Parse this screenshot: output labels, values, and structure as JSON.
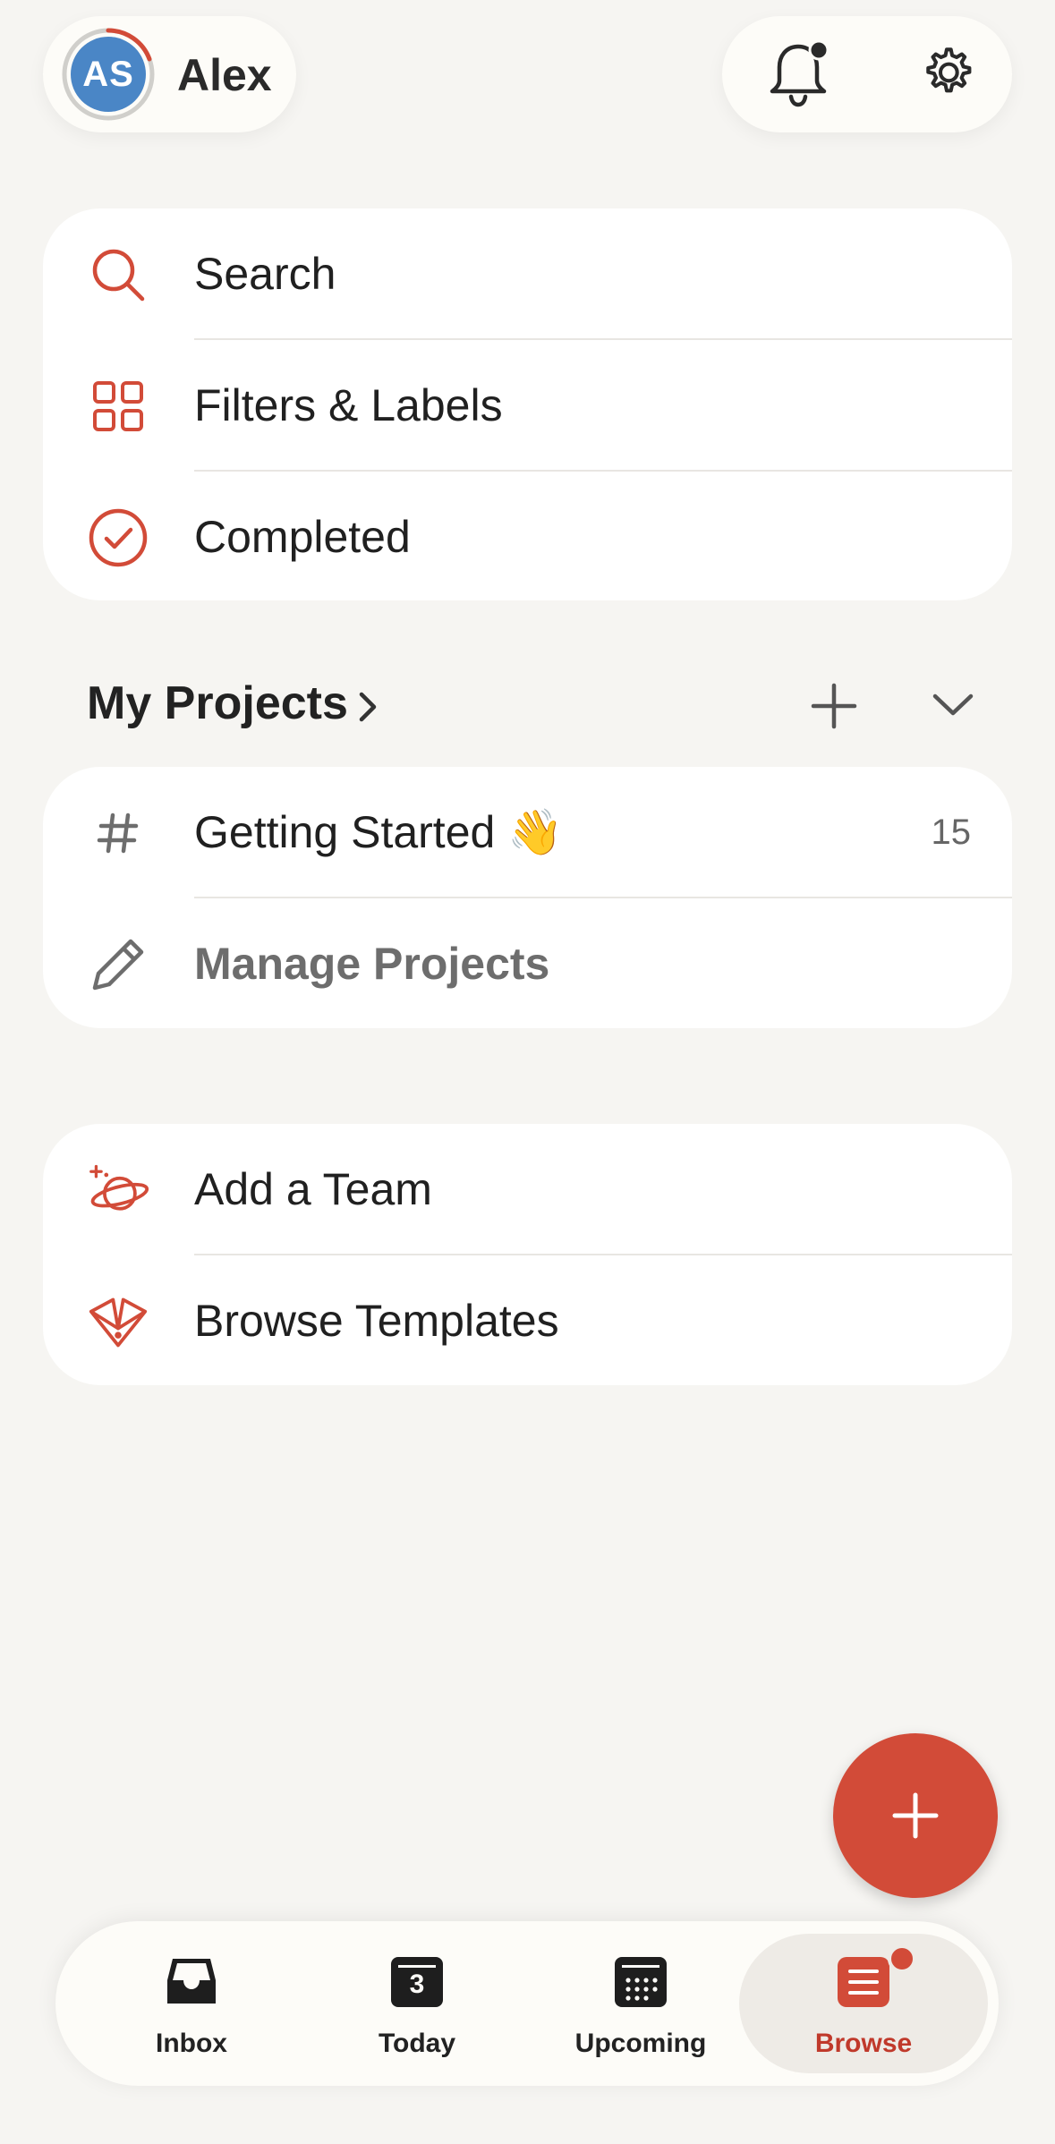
{
  "colors": {
    "accent": "#d24b38",
    "avatar": "#4a86c6",
    "background": "#f6f5f2"
  },
  "profile": {
    "initials": "AS",
    "name": "Alex"
  },
  "header_actions": {
    "notifications_icon": "bell-icon",
    "settings_icon": "gear-icon"
  },
  "quick_links": [
    {
      "label": "Search",
      "icon": "search-icon"
    },
    {
      "label": "Filters & Labels",
      "icon": "grid-icon"
    },
    {
      "label": "Completed",
      "icon": "check-circle-icon"
    }
  ],
  "projects_section": {
    "title": "My Projects"
  },
  "projects": [
    {
      "label": "Getting Started 👋",
      "count": "15",
      "icon": "hash-icon"
    },
    {
      "label": "Manage Projects",
      "icon": "pencil-icon"
    }
  ],
  "extras": [
    {
      "label": "Add a Team",
      "icon": "planet-icon"
    },
    {
      "label": "Browse Templates",
      "icon": "templates-icon"
    }
  ],
  "bottom_nav": {
    "items": [
      {
        "label": "Inbox",
        "icon": "inbox-icon"
      },
      {
        "label": "Today",
        "icon": "calendar-today-icon",
        "day": "3"
      },
      {
        "label": "Upcoming",
        "icon": "calendar-grid-icon"
      },
      {
        "label": "Browse",
        "icon": "browse-icon",
        "active": true
      }
    ]
  }
}
